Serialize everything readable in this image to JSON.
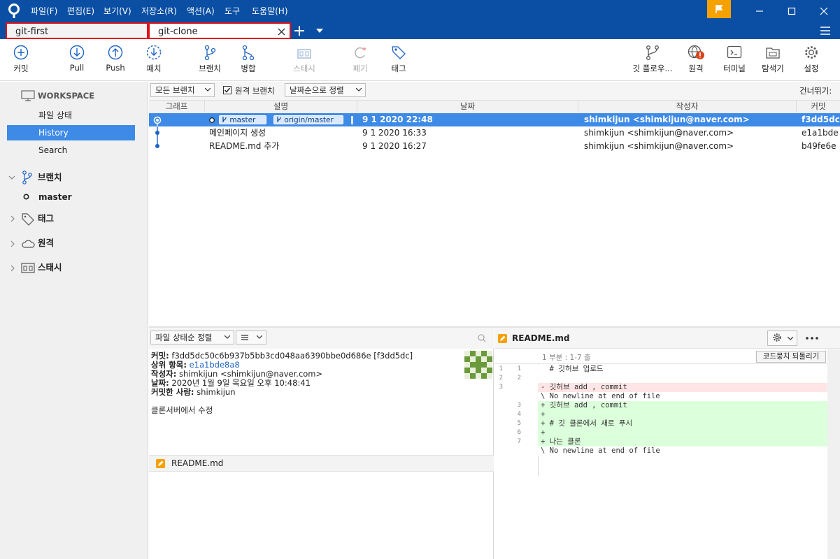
{
  "menu": [
    "파일(F)",
    "편집(E)",
    "보기(V)",
    "저장소(R)",
    "액션(A)",
    "도구",
    "도움말(H)"
  ],
  "tabs": [
    {
      "label": "git-first"
    },
    {
      "label": "git-clone"
    }
  ],
  "toolbar": {
    "left": [
      {
        "label": "커밋",
        "icon": "plus-circle-icon"
      },
      {
        "label": "Pull",
        "icon": "arrow-down-circle-icon"
      },
      {
        "label": "Push",
        "icon": "arrow-up-circle-icon"
      },
      {
        "label": "패치",
        "icon": "patch-icon"
      },
      {
        "label": "브랜치",
        "icon": "branch-icon"
      },
      {
        "label": "병합",
        "icon": "merge-icon"
      },
      {
        "label": "스태시",
        "icon": "stash-icon"
      },
      {
        "label": "폐기",
        "icon": "discard-icon"
      },
      {
        "label": "태그",
        "icon": "tag-icon"
      }
    ],
    "right": [
      {
        "label": "깃 플로우...",
        "icon": "git-flow-icon"
      },
      {
        "label": "원격",
        "icon": "remote-globe-icon"
      },
      {
        "label": "터미널",
        "icon": "terminal-icon"
      },
      {
        "label": "탐색기",
        "icon": "explorer-icon"
      },
      {
        "label": "설정",
        "icon": "gear-icon"
      }
    ]
  },
  "sidebar": {
    "workspace": "WORKSPACE",
    "workspace_items": [
      "파일 상태",
      "History",
      "Search"
    ],
    "branches": "브랜치",
    "branch_items": [
      "master"
    ],
    "tags": "태그",
    "remotes": "원격",
    "stashes": "스태시"
  },
  "filter": {
    "branches": "모든 브랜치",
    "remote_branches": "원격 브랜치",
    "sort": "날짜순으로 정렬",
    "jump": "건너뛰기:"
  },
  "columns": [
    "그래프",
    "설명",
    "날짜",
    "작성자",
    "커밋"
  ],
  "commits": [
    {
      "desc": "",
      "tags": [
        "master",
        "origin/master"
      ],
      "date": "9 1 2020 22:48",
      "author": "shimkijun <shimkijun@naver.com>",
      "hash": "f3dd5dc"
    },
    {
      "desc": "메인페이지 생성",
      "date": "9 1 2020 16:33",
      "author": "shimkijun <shimkijun@naver.com>",
      "hash": "e1a1bde"
    },
    {
      "desc": "README.md 추가",
      "date": "9 1 2020 16:27",
      "author": "shimkijun <shimkijun@naver.com>",
      "hash": "b49fe6e"
    }
  ],
  "detail": {
    "sort": "파일 상태순 정렬",
    "commit_label": "커밋:",
    "commit_value": "f3dd5dc50c6b937b5bb3cd048aa6390bbe0d686e [f3dd5dc]",
    "parent_label": "상위 항목:",
    "parent_value": "e1a1bde8a8",
    "author_label": "작성자:",
    "author_value": "shimkijun <shimkijun@naver.com>",
    "date_label": "날짜:",
    "date_value": "2020년 1월 9일 목요일 오후 10:48:41",
    "committer_label": "커밋한 사람:",
    "committer_value": "shimkijun",
    "message": "클론서버에서 수정",
    "file": "README.md"
  },
  "diff": {
    "file": "README.md",
    "hunk": "1 부분 : 1-7 줄",
    "revert": "코드뭉치 되돌리기",
    "lines": [
      {
        "o": "1",
        "n": "1",
        "t": "  # 깃허브 업로드",
        "k": "ctx"
      },
      {
        "o": "2",
        "n": "2",
        "t": "  ",
        "k": "ctx"
      },
      {
        "o": "3",
        "n": "",
        "t": "- 깃허브 add , commit",
        "k": "del"
      },
      {
        "o": "",
        "n": "",
        "t": "\\ No newline at end of file",
        "k": "ctx"
      },
      {
        "o": "",
        "n": "3",
        "t": "+ 깃허브 add , commit",
        "k": "add"
      },
      {
        "o": "",
        "n": "4",
        "t": "+",
        "k": "add"
      },
      {
        "o": "",
        "n": "5",
        "t": "+ # 깃 클론에서 새로 푸시",
        "k": "add"
      },
      {
        "o": "",
        "n": "6",
        "t": "+",
        "k": "add"
      },
      {
        "o": "",
        "n": "7",
        "t": "+ 나는 클론",
        "k": "add"
      },
      {
        "o": "",
        "n": "",
        "t": "\\ No newline at end of file",
        "k": "ctx"
      }
    ]
  }
}
